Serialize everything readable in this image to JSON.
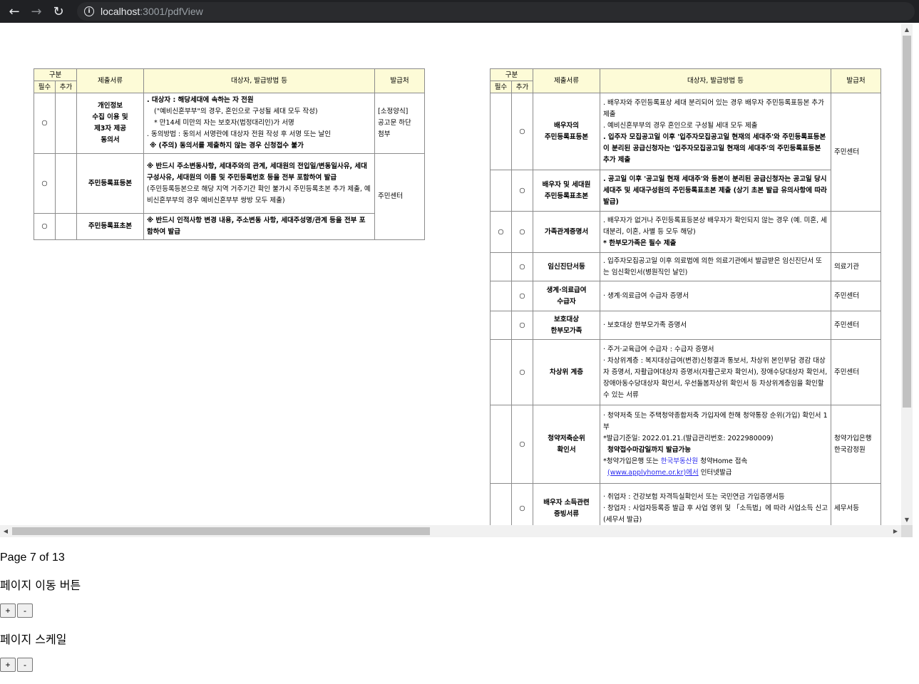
{
  "browser": {
    "url_host": "localhost",
    "url_path": ":3001/pdfView"
  },
  "left_table": {
    "headers": {
      "group": "구분",
      "required": "필수",
      "additional": "추가",
      "document": "제출서류",
      "target": "대상자, 발급방법 등",
      "issuer": "발급처"
    },
    "rows": [
      {
        "required": "○",
        "additional": "",
        "name_lines": [
          "개인정보",
          "수집 이용 및",
          "제3자 제공",
          "동의서"
        ],
        "details": [
          ". 대상자 :  해당세대에 속하는 자 전원",
          "(\"예비신혼부부\"의 경우, 혼인으로 구성될 세대 모두 작성)",
          "* 만14세 미만의 자는 보호자(법정대리인)가 서명",
          ". 동의방법 : 동의서 서명란에 대상자 전원 작성 후 서명 또는 날인",
          "※ (주의) 동의서를 제출하지 않는 경우 신청접수 불가"
        ],
        "issuer_lines": [
          "[소정양식]",
          "공고문 하단",
          "첨부"
        ]
      },
      {
        "required": "○",
        "additional": "",
        "name_lines": [
          "주민등록표등본"
        ],
        "details": [
          "※ 반드시 주소변동사항, 세대주와의 관계, 세대원의 전입일/변동일사유, 세대구성사유, 세대원의 이름 및 주민등록번호 등을 전부 포함하여 발급",
          "(주민등록등본으로 해당 지역 거주기간 확인 불가시 주민등록초본 추가 제출, 예비신혼부부의 경우 예비신혼부부 쌍방 모두 제출)"
        ],
        "issuer": "주민센터"
      },
      {
        "required": "○",
        "additional": "",
        "name_lines": [
          "주민등록표초본"
        ],
        "details": [
          "※ 반드시 인적사항 변경 내용, 주소변동 사항, 세대주성명/관계 등을 전부 포함하여 발급"
        ]
      }
    ]
  },
  "right_table": {
    "headers": {
      "group": "구분",
      "required": "필수",
      "additional": "추가",
      "document": "제출서류",
      "target": "대상자, 발급방법 등",
      "issuer": "발급처"
    },
    "rows": [
      {
        "required": "",
        "additional": "○",
        "name_lines": [
          "배우자의",
          "주민등록표등본"
        ],
        "details": [
          ". 배우자와 주민등록표상 세대 분리되어 있는 경우 배우자 주민등록표등본 추가 제출",
          ". 예비신혼부부의 경우 혼인으로 구성될 세대 모두 제출",
          ". 입주자 모집공고일 이후 '입주자모집공고일 현재의 세대주'와 주민등록표등본이 분리된 공급신청자는 '입주자모집공고일 현재의 세대주'의 주민등록표등본 추가 제출"
        ],
        "issuer": "주민센터"
      },
      {
        "required": "",
        "additional": "○",
        "name_lines": [
          "배우자 및 세대원",
          "주민등록표초본"
        ],
        "details": [
          ". 공고일 이후 '공고일 현재 세대주'와 등본이 분리된 공급신청자는 공고일 당시 세대주 및 세대구성원의 주민등록표초본 제출 (상기 초본 발급 유의사항에 따라 발급)"
        ]
      },
      {
        "required": "○",
        "additional": "○",
        "name_lines": [
          "가족관계증명서"
        ],
        "details": [
          ". 배우자가 없거나 주민등록표등본상 배우자가 확인되지 않는 경우 (예. 미혼, 세대분리, 이혼, 사별 등 모두 해당)",
          "* 한부모가족은 필수 제출"
        ]
      },
      {
        "required": "",
        "additional": "○",
        "name_lines": [
          "임신진단서등"
        ],
        "details": [
          ". 입주자모집공고일 이후 의료법에 의한 의료기관에서 발급받은 임신진단서 또는 임신확인서(병원직인 날인)"
        ],
        "issuer": "의료기관"
      },
      {
        "required": "",
        "additional": "○",
        "name_lines": [
          "생계·의료급여",
          "수급자"
        ],
        "details": [
          "· 생계·의료급여 수급자 증명서"
        ],
        "issuer": "주민센터"
      },
      {
        "required": "",
        "additional": "○",
        "name_lines": [
          "보호대상",
          "한부모가족"
        ],
        "details": [
          "· 보호대상 한부모가족 증명서"
        ],
        "issuer": "주민센터"
      },
      {
        "required": "",
        "additional": "○",
        "name_lines": [
          "차상위 계층"
        ],
        "details": [
          "· 주거·교육급여 수급자 : 수급자 증명서",
          "· 차상위계층 : 복지대상급여(변경)신청결과 통보서, 차상위 본인부담 경감 대상자 증명서, 자활급여대상자 증명서(자활근로자 확인서), 장애수당대상자 확인서, 장애아동수당대상자 확인서, 우선돌봄차상위 확인서 등 차상위계층임을 확인할 수 있는 서류"
        ],
        "issuer": "주민센터"
      },
      {
        "required": "",
        "additional": "○",
        "name_lines": [
          "청약저축순위",
          "확인서"
        ],
        "details_savings": {
          "line1": "· 청약저축 또는 주택청약종합저축 가입자에 한해 청약통장 순위(가입) 확인서 1부",
          "line2": "*발급기준일: 2022.01.21.(발급관리번호: 2022980009)",
          "line3": "청약접수마감일까지 발급가능",
          "line4_pre": "*청약가입은행 또는 ",
          "line4_link": "한국부동산원",
          "line4_post": " 청약Home 접속",
          "line5_link": "(www.applyhome.or.kr)에서",
          "line5_post": " 인터넷발급"
        },
        "issuer_lines": [
          "청약가입은행",
          "한국감정원"
        ]
      },
      {
        "required": "",
        "additional": "○",
        "name_lines": [
          "배우자 소득관련",
          "증빙서류"
        ],
        "details": [
          "· 취업자 : 건강보험 자격득실확인서 또는 국민연금 가입증명서등",
          "· 창업자 : 사업자등록증 발급 후 사업 영위 및 「소득법」에 따라 사업소득 신고(세무서 발급)"
        ],
        "issuer": "세무서등"
      }
    ]
  },
  "controls": {
    "page_info": "Page 7 of 13",
    "page_move_label": "페이지 이동 버튼",
    "page_scale_label": "페이지 스케일",
    "plus": "+",
    "minus": "-"
  }
}
